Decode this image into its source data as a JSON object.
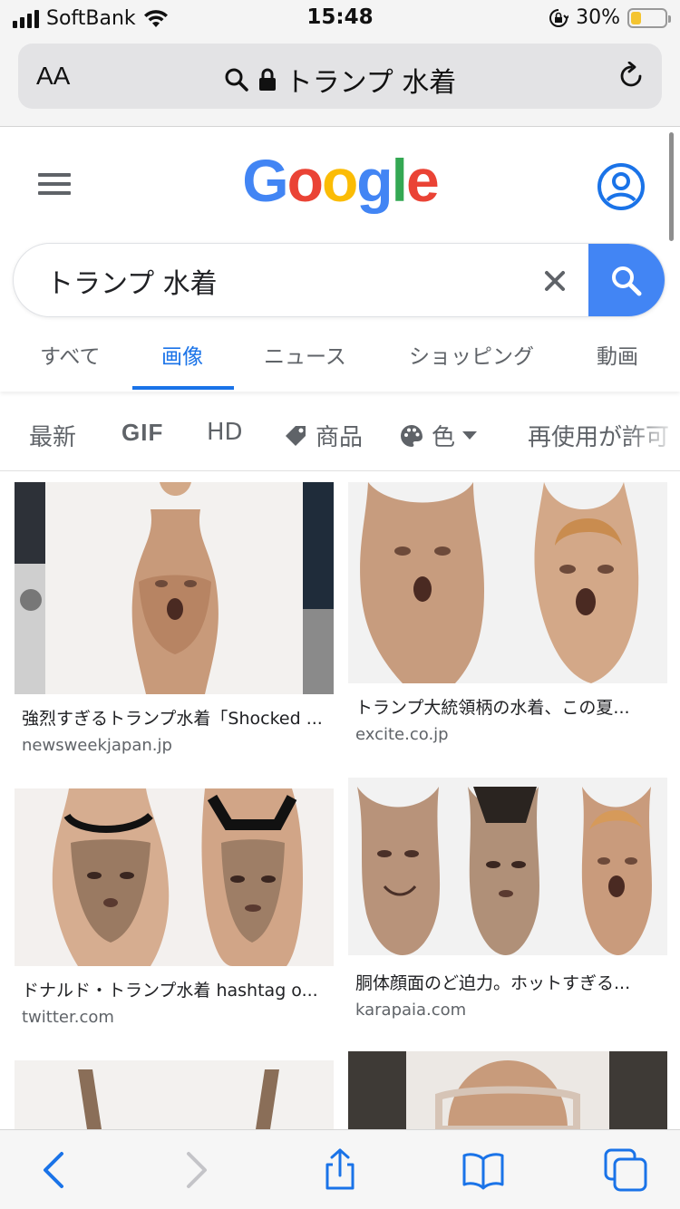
{
  "status_bar": {
    "carrier": "SoftBank",
    "time": "15:48",
    "battery_percent": "30%",
    "battery_level": 0.3
  },
  "address_bar": {
    "text_size_label": "AA",
    "url_text": "トランプ 水着",
    "icons": [
      "search-icon",
      "lock-icon",
      "reload-icon"
    ]
  },
  "google": {
    "logo": "Google",
    "logo_colors": [
      "#4285F4",
      "#EA4335",
      "#FBBC05",
      "#4285F4",
      "#34A853",
      "#EA4335"
    ],
    "search_query": "トランプ 水着"
  },
  "tabs": [
    {
      "label": "すべて",
      "active": false
    },
    {
      "label": "画像",
      "active": true
    },
    {
      "label": "ニュース",
      "active": false
    },
    {
      "label": "ショッピング",
      "active": false
    },
    {
      "label": "動画",
      "active": false
    }
  ],
  "filters": {
    "latest": "最新",
    "gif": "GIF",
    "hd": "HD",
    "products": "商品",
    "color": "色",
    "reuse": "再使用が許可"
  },
  "results": [
    {
      "title": "強烈すぎるトランプ水着「Shocked ...",
      "domain": "newsweekjapan.jp"
    },
    {
      "title": "トランプ大統領柄の水着、この夏...",
      "domain": "excite.co.jp"
    },
    {
      "title": "ドナルド・トランプ水着 hashtag o...",
      "domain": "twitter.com"
    },
    {
      "title": "胴体顔面のど迫力。ホットすぎる...",
      "domain": "karapaia.com"
    }
  ],
  "toolbar": {
    "icons": [
      "back-icon",
      "forward-icon",
      "share-icon",
      "bookmarks-icon",
      "tabs-icon"
    ]
  },
  "colors": {
    "accent": "#1a73e8",
    "search_button": "#4285f4",
    "battery": "#f4c430"
  }
}
